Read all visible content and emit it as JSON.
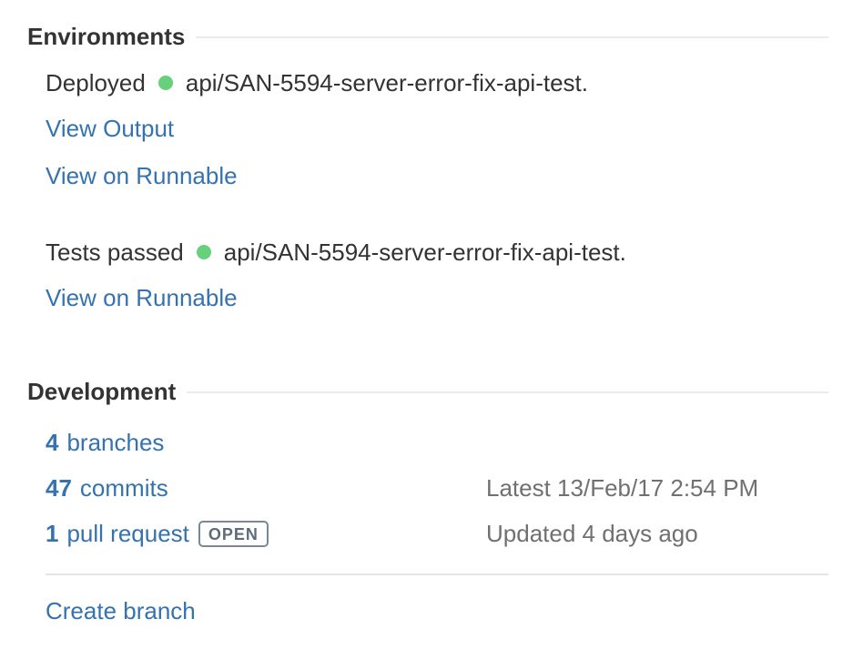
{
  "environments": {
    "title": "Environments",
    "deployed": {
      "label": "Deployed",
      "branch": "api/SAN-5594-server-error-fix-api-test.",
      "status_color": "#66d17a"
    },
    "view_output_label": "View Output",
    "view_on_runnable_label_1": "View on Runnable",
    "tests": {
      "label": "Tests passed",
      "branch": "api/SAN-5594-server-error-fix-api-test.",
      "status_color": "#66d17a"
    },
    "view_on_runnable_label_2": "View on Runnable"
  },
  "development": {
    "title": "Development",
    "branches": {
      "count": "4",
      "label": "branches"
    },
    "commits": {
      "count": "47",
      "label": "commits",
      "meta": "Latest 13/Feb/17 2:54 PM"
    },
    "pull_requests": {
      "count": "1",
      "label": "pull request",
      "badge": "OPEN",
      "meta": "Updated 4 days ago"
    },
    "create_branch_label": "Create branch"
  },
  "colors": {
    "link": "#3572b0",
    "text": "#333333",
    "muted": "#707070",
    "success": "#66d17a"
  },
  "icons": {
    "deployed_status": "green-status-dot-icon",
    "tests_status": "green-status-dot-icon"
  }
}
